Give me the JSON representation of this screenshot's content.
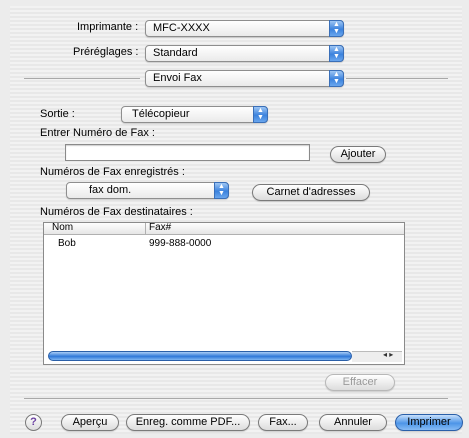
{
  "printer": {
    "label": "Imprimante :",
    "value": "MFC-XXXX"
  },
  "presets": {
    "label": "Préréglages :",
    "value": "Standard"
  },
  "panel": {
    "value": "Envoi Fax"
  },
  "output": {
    "label": "Sortie :",
    "value": "Télécopieur"
  },
  "fax_entry": {
    "label": "Entrer Numéro de Fax :",
    "value": "",
    "add_label": "Ajouter"
  },
  "saved": {
    "label": "Numéros de Fax enregistrés :",
    "value": "fax dom.",
    "address_book_label": "Carnet d'adresses"
  },
  "recipients": {
    "label": "Numéros de Fax destinataires :",
    "columns": [
      "Nom",
      "Fax#"
    ],
    "rows": [
      {
        "name": "Bob",
        "fax": "999-888-0000"
      }
    ]
  },
  "clear_label": "Effacer",
  "footer": {
    "help_label": "?",
    "preview_label": "Aperçu",
    "save_pdf_label": "Enreg. comme PDF...",
    "fax_label": "Fax...",
    "cancel_label": "Annuler",
    "print_label": "Imprimer"
  },
  "colors": {
    "accent": "#4d95e8",
    "selection": "#3b82dd"
  },
  "icons": {
    "popup": "up-down-arrows-icon",
    "help": "question-mark-icon"
  }
}
